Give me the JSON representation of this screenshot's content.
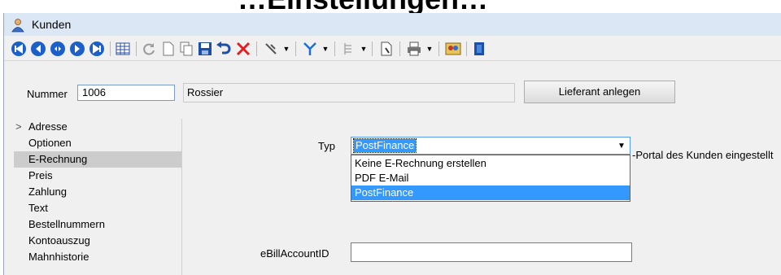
{
  "top_heading": "…Einstellungen…",
  "window": {
    "title": "Kunden",
    "icon": "users-icon"
  },
  "toolbar": {
    "buttons": [
      {
        "name": "first-record-button",
        "icon": "first-icon"
      },
      {
        "name": "previous-record-button",
        "icon": "previous-icon"
      },
      {
        "name": "record-search-button",
        "icon": "search-record-icon"
      },
      {
        "name": "next-record-button",
        "icon": "next-icon"
      },
      {
        "name": "last-record-button",
        "icon": "last-icon"
      },
      {
        "name": "table-view-button",
        "icon": "table-icon"
      },
      {
        "name": "refresh-button",
        "icon": "refresh-icon"
      },
      {
        "name": "new-button",
        "icon": "new-document-icon"
      },
      {
        "name": "copy-button",
        "icon": "copy-icon"
      },
      {
        "name": "save-button",
        "icon": "save-icon"
      },
      {
        "name": "undo-button",
        "icon": "undo-icon"
      },
      {
        "name": "delete-button",
        "icon": "delete-icon"
      },
      {
        "name": "pin-button",
        "icon": "pin-icon"
      },
      {
        "name": "filter-button",
        "icon": "filter-icon"
      },
      {
        "name": "structure-button",
        "icon": "tree-icon"
      },
      {
        "name": "document-button",
        "icon": "document-icon"
      },
      {
        "name": "print-button",
        "icon": "print-icon"
      },
      {
        "name": "contacts-button",
        "icon": "contacts-icon"
      },
      {
        "name": "exit-button",
        "icon": "exit-door-icon"
      }
    ]
  },
  "form": {
    "nummer_label": "Nummer",
    "nummer_value": "1006",
    "name_value": "Rossier",
    "lieferant_button": "Lieferant anlegen"
  },
  "nav": {
    "items": [
      {
        "label": "Adresse",
        "selected": false,
        "expandable": true
      },
      {
        "label": "Optionen",
        "selected": false
      },
      {
        "label": "E-Rechnung",
        "selected": true
      },
      {
        "label": "Preis",
        "selected": false
      },
      {
        "label": "Zahlung",
        "selected": false
      },
      {
        "label": "Text",
        "selected": false
      },
      {
        "label": "Bestellnummern",
        "selected": false
      },
      {
        "label": "Kontoauszug",
        "selected": false
      },
      {
        "label": "Mahnhistorie",
        "selected": false
      }
    ]
  },
  "erechnung": {
    "typ_label": "Typ",
    "typ_selected": "PostFinance",
    "options": [
      "Keine E-Rechnung erstellen",
      "PDF E-Mail",
      "PostFinance"
    ],
    "behind_text": "-Portal des Kunden eingestellt",
    "ebill_label": "eBillAccountID",
    "ebill_value": ""
  }
}
